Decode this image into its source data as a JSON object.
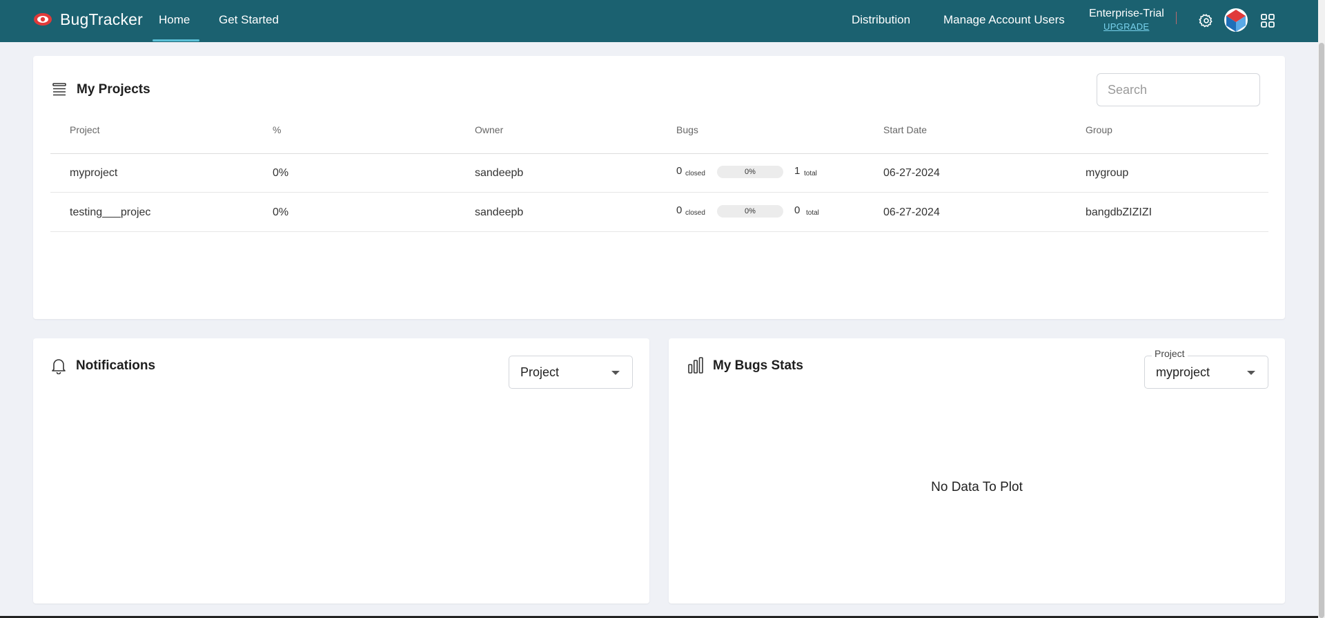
{
  "topbar": {
    "brand": "BugTracker",
    "nav_home": "Home",
    "nav_get_started": "Get Started",
    "nav_distribution": "Distribution",
    "nav_manage_users": "Manage Account Users",
    "plan": "Enterprise-Trial",
    "upgrade": "UPGRADE",
    "colors": {
      "bar": "#1b6170",
      "accent": "#5bc0d6",
      "logo": "#e03a3a"
    }
  },
  "projects": {
    "title": "My Projects",
    "search_placeholder": "Search",
    "columns": [
      "Project",
      "%",
      "Owner",
      "Bugs",
      "Start Date",
      "Group"
    ],
    "rows": [
      {
        "name": "myproject",
        "percent": "0%",
        "owner": "sandeepb",
        "closed": "0",
        "closed_label": "closed",
        "bar": "0%",
        "total": "1",
        "total_label": "total",
        "start_date": "06-27-2024",
        "group": "mygroup"
      },
      {
        "name": "testing___projec",
        "percent": "0%",
        "owner": "sandeepb",
        "closed": "0",
        "closed_label": "closed",
        "bar": "0%",
        "total": "0",
        "total_label": "total",
        "start_date": "06-27-2024",
        "group": "bangdbZIZIZI"
      }
    ]
  },
  "notifications": {
    "title": "Notifications",
    "filter_value": "Project"
  },
  "stats": {
    "title": "My Bugs Stats",
    "project_label": "Project",
    "project_value": "myproject",
    "empty_text": "No Data To Plot"
  }
}
